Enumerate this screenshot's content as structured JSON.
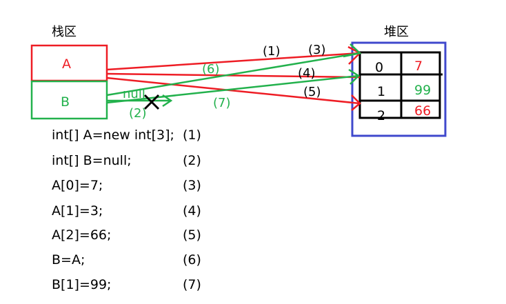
{
  "labels": {
    "stack": "栈区",
    "heap": "堆区",
    "var_a": "A",
    "var_b": "B",
    "null": "null"
  },
  "heap_table": [
    {
      "index": "0",
      "value": "7",
      "color": "#ee1c24"
    },
    {
      "index": "1",
      "value": "99",
      "color": "#22b14c"
    },
    {
      "index": "2",
      "value": "66",
      "color": "#ee1c24"
    }
  ],
  "arrow_labels": {
    "s1": "(1)",
    "s2": "(2)",
    "s3": "(3)",
    "s4": "(4)",
    "s5": "(5)",
    "s6": "(6)",
    "s7": "(7)"
  },
  "code": [
    {
      "stmt": "int[] A=new int[3];",
      "step": "(1)"
    },
    {
      "stmt": "int[] B=null;",
      "step": "(2)"
    },
    {
      "stmt": "A[0]=7;",
      "step": "(3)"
    },
    {
      "stmt": "A[1]=3;",
      "step": "(4)"
    },
    {
      "stmt": "A[2]=66;",
      "step": "(5)"
    },
    {
      "stmt": "B=A;",
      "step": "(6)"
    },
    {
      "stmt": "B[1]=99;",
      "step": "(7)"
    }
  ],
  "colors": {
    "red": "#ee1c24",
    "green": "#22b14c",
    "blue": "#3f48cc"
  }
}
